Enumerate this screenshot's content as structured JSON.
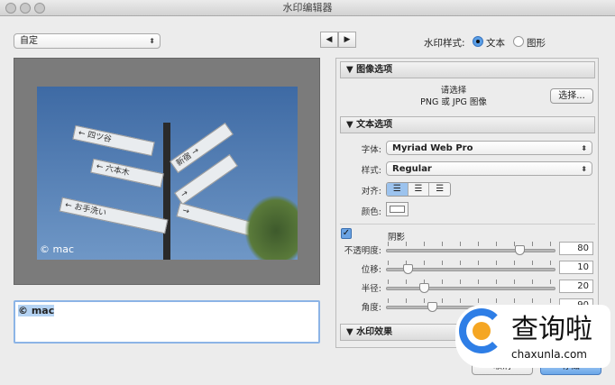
{
  "window": {
    "title": "水印编辑器"
  },
  "preset": {
    "value": "自定"
  },
  "preview": {
    "overlay_text": "© mac",
    "sign_texts": [
      "四ツ谷",
      "六本木",
      "お手洗い",
      "新宿"
    ]
  },
  "text_input": {
    "value": "© mac"
  },
  "nav": {
    "prev": "◀",
    "next": "▶"
  },
  "style": {
    "label": "水印样式:",
    "options": [
      {
        "label": "文本",
        "selected": true
      },
      {
        "label": "图形",
        "selected": false
      }
    ]
  },
  "image_options": {
    "header": "图像选项",
    "prompt_line1": "请选择",
    "prompt_line2": "PNG 或 JPG 图像",
    "choose_button": "选择..."
  },
  "text_options": {
    "header": "文本选项",
    "font_label": "字体:",
    "font_value": "Myriad Web Pro",
    "style_label": "样式:",
    "style_value": "Regular",
    "align_label": "对齐:",
    "color_label": "颜色:"
  },
  "shadow": {
    "label": "阴影",
    "enabled": true,
    "sliders": [
      {
        "label": "不透明度:",
        "value": "80",
        "fraction": 0.8
      },
      {
        "label": "位移:",
        "value": "10",
        "fraction": 0.1
      },
      {
        "label": "半径:",
        "value": "20",
        "fraction": 0.2
      },
      {
        "label": "角度:",
        "value": "90",
        "fraction": 0.25
      }
    ]
  },
  "effects": {
    "header": "水印效果"
  },
  "footer": {
    "cancel": "取消",
    "save": "存储"
  },
  "watermark_logo": {
    "text": "查询啦",
    "url": "chaxunla.com"
  }
}
